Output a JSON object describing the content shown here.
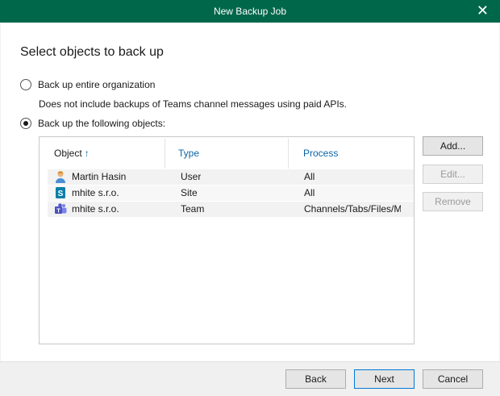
{
  "window": {
    "title": "New Backup Job",
    "close_glyph": "✕"
  },
  "page": {
    "heading": "Select objects to back up"
  },
  "options": {
    "entire_org": {
      "label": "Back up entire organization",
      "checked": false
    },
    "entire_org_note": "Does not include backups of Teams channel messages using paid APIs.",
    "following": {
      "label": "Back up the following objects:",
      "checked": true
    }
  },
  "table": {
    "columns": {
      "object": "Object",
      "type": "Type",
      "process": "Process"
    },
    "sort_indicator": "↑",
    "rows": [
      {
        "object": "Martin Hasin",
        "type": "User",
        "process": "All",
        "icon": "user-icon"
      },
      {
        "object": "mhite s.r.o.",
        "type": "Site",
        "process": "All",
        "icon": "sharepoint-site-icon"
      },
      {
        "object": "mhite s.r.o.",
        "type": "Team",
        "process": "Channels/Tabs/Files/M",
        "icon": "teams-icon"
      }
    ]
  },
  "side_buttons": {
    "add": "Add...",
    "edit": "Edit...",
    "remove": "Remove"
  },
  "footer": {
    "back": "Back",
    "next": "Next",
    "cancel": "Cancel"
  },
  "colors": {
    "titlebar": "#00674a",
    "accent_blue": "#0a64a8"
  }
}
